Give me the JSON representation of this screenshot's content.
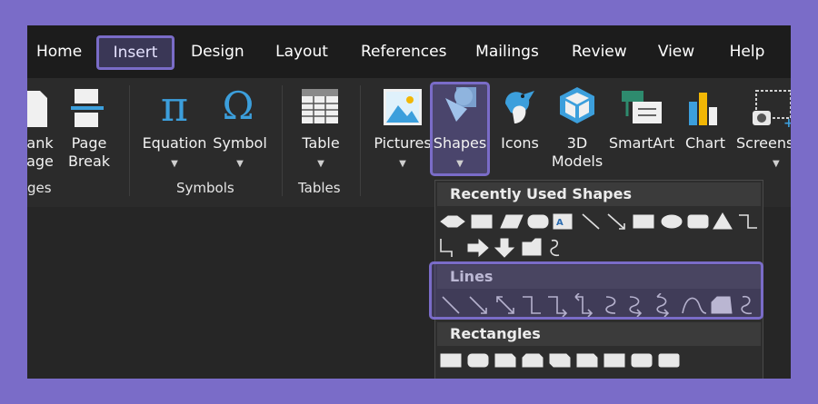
{
  "tabs": [
    {
      "label": "Home"
    },
    {
      "label": "Insert",
      "active": true
    },
    {
      "label": "Design"
    },
    {
      "label": "Layout"
    },
    {
      "label": "References"
    },
    {
      "label": "Mailings"
    },
    {
      "label": "Review"
    },
    {
      "label": "View"
    },
    {
      "label": "Help"
    }
  ],
  "ribbon": {
    "blank_page": {
      "line1": "ank",
      "line2": "age"
    },
    "page_break": {
      "line1": "Page",
      "line2": "Break"
    },
    "pages_group": "ges",
    "equation": "Equation",
    "symbol": "Symbol",
    "symbols_group": "Symbols",
    "table": "Table",
    "tables_group": "Tables",
    "pictures": "Pictures",
    "shapes": "Shapes",
    "icons": "Icons",
    "models": {
      "line1": "3D",
      "line2": "Models"
    },
    "smartart": "SmartArt",
    "chart": "Chart",
    "screenshot": "Screens",
    "equation_glyph": "π",
    "symbol_glyph": "Ω"
  },
  "dropdown": {
    "recent_header": "Recently Used Shapes",
    "lines_header": "Lines",
    "rectangles_header": "Rectangles",
    "textbox_glyph": "A"
  },
  "colors": {
    "accent": "#7a6cc8",
    "background": "#262626",
    "text": "#ffffff",
    "icon_blue": "#3c9fdc"
  }
}
